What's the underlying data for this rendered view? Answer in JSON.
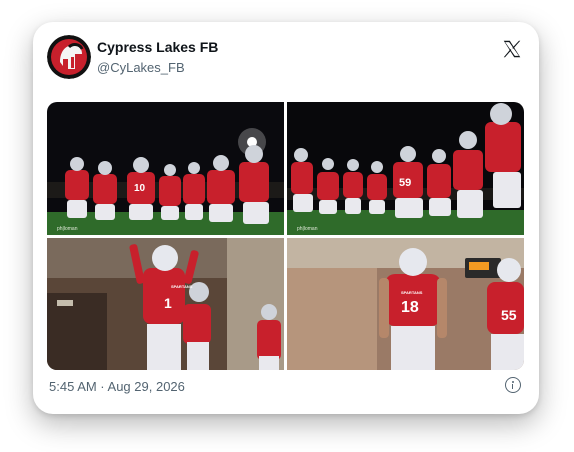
{
  "post": {
    "display_name": "Cypress Lakes FB",
    "handle": "@CyLakes_FB",
    "timestamp": "5:45 AM · Aug 29, 2026"
  },
  "media": {
    "photo_credits": [
      "ph|loman",
      "ph|loman"
    ],
    "jersey_numbers": [
      "10",
      "59",
      "1",
      "18",
      "55"
    ],
    "jersey_text": "SPARTANS"
  },
  "icons": {
    "avatar": "spartan-helmet-logo",
    "platform_logo": "x-logo-icon",
    "info": "info-icon"
  },
  "colors": {
    "team_red": "#c8202c",
    "field_green": "#2f6b2a",
    "night_sky": "#0a0a0e"
  }
}
